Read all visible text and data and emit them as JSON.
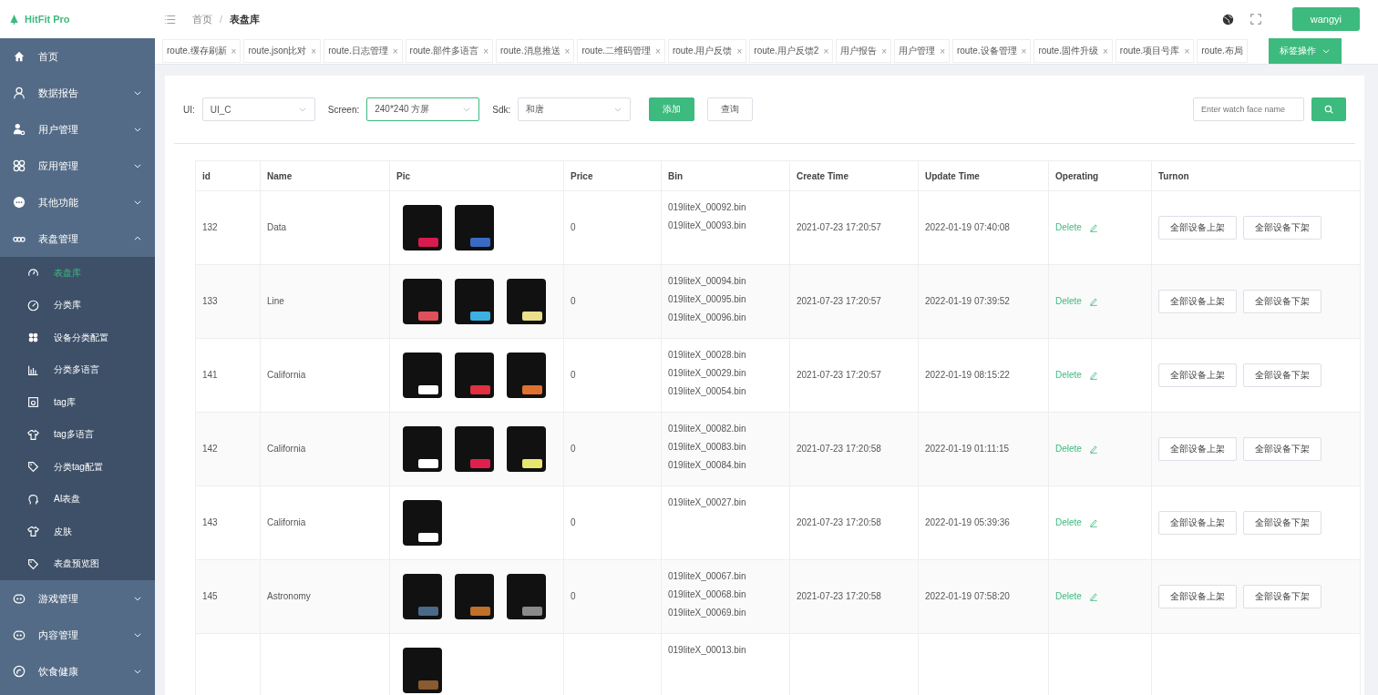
{
  "header": {
    "logo": "HitFit Pro",
    "breadcrumb": [
      {
        "label": "首页",
        "current": false
      },
      {
        "label": "表盘库",
        "current": true
      }
    ],
    "breadcrumb_separator": "/",
    "user": "wangyi"
  },
  "sidebar": {
    "items": [
      {
        "label": "首页",
        "kind": "link",
        "selected": false
      },
      {
        "label": "数据报告",
        "kind": "group",
        "expanded": false
      },
      {
        "label": "用户管理",
        "kind": "group",
        "expanded": false
      },
      {
        "label": "应用管理",
        "kind": "group",
        "expanded": false
      },
      {
        "label": "其他功能",
        "kind": "group",
        "expanded": false
      },
      {
        "label": "表盘管理",
        "kind": "group",
        "expanded": true,
        "children": [
          {
            "label": "表盘库",
            "selected": true
          },
          {
            "label": "分类库",
            "selected": false
          },
          {
            "label": "设备分类配置",
            "selected": false
          },
          {
            "label": "分类多语言",
            "selected": false
          },
          {
            "label": "tag库",
            "selected": false
          },
          {
            "label": "tag多语言",
            "selected": false
          },
          {
            "label": "分类tag配置",
            "selected": false
          },
          {
            "label": "AI表盘",
            "selected": false
          },
          {
            "label": "皮肤",
            "selected": false
          },
          {
            "label": "表盘预览图",
            "selected": false
          }
        ]
      },
      {
        "label": "游戏管理",
        "kind": "group",
        "expanded": false
      },
      {
        "label": "内容管理",
        "kind": "group",
        "expanded": false
      },
      {
        "label": "饮食健康",
        "kind": "group",
        "expanded": false
      }
    ]
  },
  "tabs": [
    {
      "label": "route.缓存刷新",
      "selected": false,
      "closable": true
    },
    {
      "label": "route.json比对",
      "selected": false,
      "closable": true
    },
    {
      "label": "route.日志管理",
      "selected": false,
      "closable": true
    },
    {
      "label": "route.部件多语言",
      "selected": false,
      "closable": true
    },
    {
      "label": "route.消息推送",
      "selected": false,
      "closable": true
    },
    {
      "label": "route.二维码管理",
      "selected": false,
      "closable": true
    },
    {
      "label": "route.用户反馈",
      "selected": false,
      "closable": true
    },
    {
      "label": "route.用户反馈2",
      "selected": false,
      "closable": true
    },
    {
      "label": "用户报告",
      "selected": false,
      "closable": true
    },
    {
      "label": "用户管理",
      "selected": false,
      "closable": true
    },
    {
      "label": "route.设备管理",
      "selected": false,
      "closable": true
    },
    {
      "label": "route.固件升级",
      "selected": false,
      "closable": true
    },
    {
      "label": "route.项目号库",
      "selected": false,
      "closable": true
    },
    {
      "label": "route.布局",
      "selected": false,
      "closable": false
    }
  ],
  "tab_close": "×",
  "tab_actions": "标签操作",
  "filters": [
    {
      "label": "UI:",
      "value": "UI_C",
      "focused": false
    },
    {
      "label": "Screen:",
      "value": "240*240 方屏",
      "focused": true
    },
    {
      "label": "Sdk:",
      "value": "和唐",
      "focused": false
    }
  ],
  "buttons": [
    {
      "label": "添加",
      "kind": "primary"
    },
    {
      "label": "查询",
      "kind": "default"
    }
  ],
  "search": {
    "placeholder": "Enter watch face name"
  },
  "table": {
    "columns": [
      "id",
      "Name",
      "Pic",
      "Price",
      "Bin",
      "Create Time",
      "Update Time",
      "Operating",
      "Turnon"
    ],
    "rows": [
      {
        "id": "132",
        "name": "Data",
        "pics": [
          {
            "color": "#d81b4f"
          },
          {
            "color": "#3a6bc4"
          }
        ],
        "price": "0",
        "bins": [
          "019liteX_00092.bin",
          "019liteX_00093.bin"
        ],
        "create_time": "2021-07-23 17:20:57",
        "update_time": "2022-01-19 07:40:08",
        "operation": "Delete",
        "turnon": [
          "全部设备上架",
          "全部设备下架"
        ]
      },
      {
        "id": "133",
        "name": "Line",
        "pics": [
          {
            "color": "#e0505a"
          },
          {
            "color": "#3cb0e0"
          },
          {
            "color": "#e8e08a"
          }
        ],
        "price": "0",
        "bins": [
          "019liteX_00094.bin",
          "019liteX_00095.bin",
          "019liteX_00096.bin"
        ],
        "create_time": "2021-07-23 17:20:57",
        "update_time": "2022-01-19 07:39:52",
        "operation": "Delete",
        "turnon": [
          "全部设备上架",
          "全部设备下架"
        ]
      },
      {
        "id": "141",
        "name": "California",
        "pics": [
          {
            "color": "#ffffff"
          },
          {
            "color": "#e03040"
          },
          {
            "color": "#e07030"
          }
        ],
        "price": "0",
        "bins": [
          "019liteX_00028.bin",
          "019liteX_00029.bin",
          "019liteX_00054.bin"
        ],
        "create_time": "2021-07-23 17:20:57",
        "update_time": "2022-01-19 08:15:22",
        "operation": "Delete",
        "turnon": [
          "全部设备上架",
          "全部设备下架"
        ]
      },
      {
        "id": "142",
        "name": "California",
        "pics": [
          {
            "color": "#ffffff"
          },
          {
            "color": "#e0204a"
          },
          {
            "color": "#e8e870"
          }
        ],
        "price": "0",
        "bins": [
          "019liteX_00082.bin",
          "019liteX_00083.bin",
          "019liteX_00084.bin"
        ],
        "create_time": "2021-07-23 17:20:58",
        "update_time": "2022-01-19 01:11:15",
        "operation": "Delete",
        "turnon": [
          "全部设备上架",
          "全部设备下架"
        ]
      },
      {
        "id": "143",
        "name": "California",
        "pics": [
          {
            "color": "#ffffff"
          }
        ],
        "price": "0",
        "bins": [
          "019liteX_00027.bin"
        ],
        "create_time": "2021-07-23 17:20:58",
        "update_time": "2022-01-19 05:39:36",
        "operation": "Delete",
        "turnon": [
          "全部设备上架",
          "全部设备下架"
        ]
      },
      {
        "id": "145",
        "name": "Astronomy",
        "pics": [
          {
            "color": "#4a6a88"
          },
          {
            "color": "#c07028"
          },
          {
            "color": "#8a8a8a"
          }
        ],
        "price": "0",
        "bins": [
          "019liteX_00067.bin",
          "019liteX_00068.bin",
          "019liteX_00069.bin"
        ],
        "create_time": "2021-07-23 17:20:58",
        "update_time": "2022-01-19 07:58:20",
        "operation": "Delete",
        "turnon": [
          "全部设备上架",
          "全部设备下架"
        ]
      },
      {
        "pics": [
          {
            "color": "#8a5a30"
          }
        ],
        "bins": [
          "019liteX_00013.bin"
        ]
      }
    ]
  }
}
